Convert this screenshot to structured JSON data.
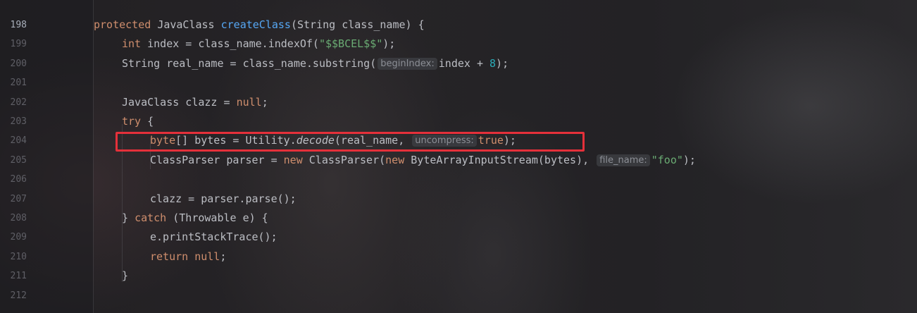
{
  "editor": {
    "lines": [
      {
        "num": "198",
        "current": true,
        "indent": 0,
        "tokens": [
          {
            "t": "protected ",
            "c": "kw"
          },
          {
            "t": "JavaClass ",
            "c": ""
          },
          {
            "t": "createClass",
            "c": "fn"
          },
          {
            "t": "(String class_name) {",
            "c": ""
          }
        ]
      },
      {
        "num": "199",
        "indent": 1,
        "tokens": [
          {
            "t": "int ",
            "c": "kw"
          },
          {
            "t": "index = class_name.indexOf(",
            "c": ""
          },
          {
            "t": "\"$$BCEL$$\"",
            "c": "str"
          },
          {
            "t": ");",
            "c": ""
          }
        ]
      },
      {
        "num": "200",
        "indent": 1,
        "tokens": [
          {
            "t": "String real_name = class_name.substring(",
            "c": ""
          },
          {
            "hint": "beginIndex:"
          },
          {
            "t": "index + ",
            "c": ""
          },
          {
            "t": "8",
            "c": "num"
          },
          {
            "t": ");",
            "c": ""
          }
        ]
      },
      {
        "num": "201",
        "indent": 1,
        "tokens": []
      },
      {
        "num": "202",
        "indent": 1,
        "tokens": [
          {
            "t": "JavaClass clazz = ",
            "c": ""
          },
          {
            "t": "null",
            "c": "kw"
          },
          {
            "t": ";",
            "c": ""
          }
        ]
      },
      {
        "num": "203",
        "indent": 1,
        "tokens": [
          {
            "t": "try ",
            "c": "kw"
          },
          {
            "t": "{",
            "c": ""
          }
        ]
      },
      {
        "num": "204",
        "indent": 2,
        "tokens": [
          {
            "t": "byte",
            "c": "kw"
          },
          {
            "t": "[] bytes = Utility.",
            "c": ""
          },
          {
            "t": "decode",
            "c": "it"
          },
          {
            "t": "(real_name, ",
            "c": ""
          },
          {
            "hint": "uncompress:"
          },
          {
            "t": "true",
            "c": "kw"
          },
          {
            "t": ");",
            "c": ""
          }
        ]
      },
      {
        "num": "205",
        "indent": 2,
        "tokens": [
          {
            "t": "ClassParser parser = ",
            "c": ""
          },
          {
            "t": "new ",
            "c": "kw"
          },
          {
            "t": "ClassParser(",
            "c": ""
          },
          {
            "t": "new ",
            "c": "kw"
          },
          {
            "t": "ByteArrayInputStream(bytes), ",
            "c": ""
          },
          {
            "hint": "file_name:"
          },
          {
            "t": "\"foo\"",
            "c": "str"
          },
          {
            "t": ");",
            "c": ""
          }
        ]
      },
      {
        "num": "206",
        "indent": 2,
        "tokens": []
      },
      {
        "num": "207",
        "indent": 2,
        "tokens": [
          {
            "t": "clazz = parser.parse();",
            "c": ""
          }
        ]
      },
      {
        "num": "208",
        "indent": 1,
        "tokens": [
          {
            "t": "} ",
            "c": ""
          },
          {
            "t": "catch ",
            "c": "kw"
          },
          {
            "t": "(Throwable e) {",
            "c": ""
          }
        ]
      },
      {
        "num": "209",
        "indent": 2,
        "tokens": [
          {
            "t": "e.printStackTrace();",
            "c": ""
          }
        ]
      },
      {
        "num": "210",
        "indent": 2,
        "tokens": [
          {
            "t": "return null",
            "c": "kw"
          },
          {
            "t": ";",
            "c": ""
          }
        ]
      },
      {
        "num": "211",
        "indent": 1,
        "tokens": [
          {
            "t": "}",
            "c": ""
          }
        ]
      },
      {
        "num": "212",
        "indent": 1,
        "tokens": []
      }
    ],
    "highlighted_line": "204",
    "highlight_color": "#e5303a"
  }
}
